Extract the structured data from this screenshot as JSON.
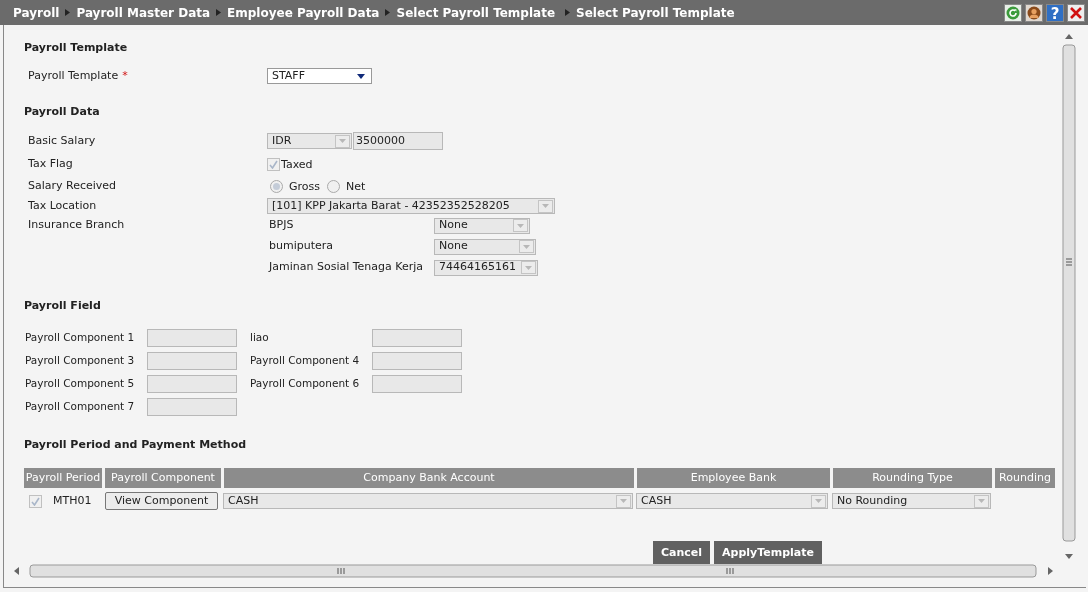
{
  "breadcrumb": [
    "Payroll",
    "Payroll Master Data",
    "Employee Payroll Data",
    "Select Payroll Template",
    "Select Payroll Template"
  ],
  "toolbar": [
    {
      "kind": "refresh"
    },
    {
      "kind": "user"
    },
    {
      "kind": "help",
      "text": "?"
    },
    {
      "kind": "close"
    }
  ],
  "payroll_template": {
    "heading": "Payroll Template",
    "label": "Payroll Template",
    "required_mark": "*",
    "value": "STAFF"
  },
  "payroll_data": {
    "heading": "Payroll Data",
    "basic_salary": {
      "label": "Basic Salary",
      "currency": "IDR",
      "amount": "3500000"
    },
    "tax_flag": {
      "label": "Tax Flag",
      "option": "Taxed",
      "checked": true
    },
    "salary_received": {
      "label": "Salary Received",
      "options": [
        {
          "label": "Gross",
          "selected": true
        },
        {
          "label": "Net",
          "selected": false
        }
      ]
    },
    "tax_location": {
      "label": "Tax Location",
      "value": "[101] KPP Jakarta Barat - 42352352528205"
    },
    "insurance_branch": {
      "label": "Insurance Branch",
      "items": [
        {
          "label": "BPJS",
          "value": "None"
        },
        {
          "label": "bumiputera",
          "value": "None"
        },
        {
          "label": "Jaminan Sosial Tenaga Kerja",
          "value": "74464165161"
        }
      ]
    }
  },
  "payroll_field": {
    "heading": "Payroll Field",
    "components": [
      {
        "label": "Payroll Component 1"
      },
      {
        "label": "liao"
      },
      {
        "label": "Payroll Component 3"
      },
      {
        "label": "Payroll Component 4"
      },
      {
        "label": "Payroll Component 5"
      },
      {
        "label": "Payroll Component 6"
      },
      {
        "label": "Payroll Component 7"
      }
    ]
  },
  "payment": {
    "heading": "Payroll Period and Payment Method",
    "columns": [
      "Payroll Period",
      "Payroll Component",
      "Company Bank Account",
      "Employee Bank",
      "Rounding Type",
      "Rounding"
    ],
    "rows": [
      {
        "checked": true,
        "period": "MTH01",
        "button": "View Component",
        "company_bank": "CASH",
        "employee_bank": "CASH",
        "rounding_type": "No Rounding"
      }
    ]
  },
  "buttons": [
    "Cancel",
    "ApplyTemplate"
  ]
}
